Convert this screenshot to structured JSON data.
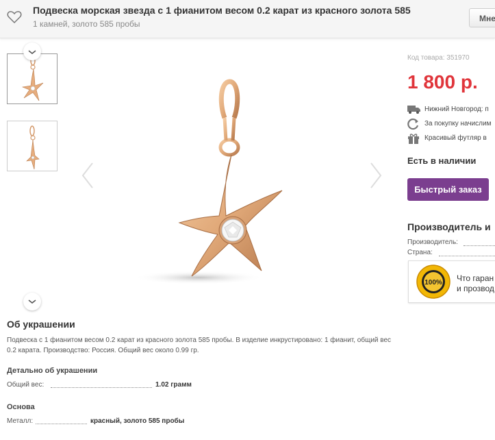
{
  "header": {
    "title": "Подвеска морская звезда с 1 фианитом весом 0.2 карат из красного золота 585",
    "subtitle": "1 камней, золото 585 пробы",
    "menu_label": "Мне"
  },
  "gallery": {
    "thumbnails": [
      {
        "icon": "starfish-pendant-front"
      },
      {
        "icon": "starfish-pendant-side"
      }
    ],
    "up_icon": "chevron-up-icon",
    "down_icon": "chevron-down-icon",
    "prev_icon": "chevron-left-icon",
    "next_icon": "chevron-right-icon"
  },
  "product": {
    "sku": "Код товара: 351970",
    "price": "1 800 р.",
    "delivery": "Нижний Новгород: п",
    "bonus": "За покупку начислим",
    "gift_box": "Красивый футляр в",
    "stock": "Есть в наличии",
    "quick_order": "Быстрый заказ"
  },
  "manufacturer": {
    "title": "Производитель и",
    "producer_label": "Производитель:",
    "country_label": "Страна:"
  },
  "guarantee": {
    "line1": "Что гаран",
    "line2": "и прозвод",
    "seal_text": "100%"
  },
  "about": {
    "title": "Об украшении",
    "text": "Подвеска с 1 фианитом весом 0.2 карат из красного золота 585 пробы. В изделие инкрустировано: 1 фианит, общий вес 0.2 карата. Производство: Россия. Общий вес около 0.99 гр."
  },
  "details": {
    "title": "Детально об украшении",
    "weight_label": "Общий вес:",
    "weight_value": "1.02 грамм"
  },
  "basis": {
    "title": "Основа",
    "metal_label": "Металл:",
    "metal_value": "красный, золото 585 пробы"
  },
  "colors": {
    "price": "#e0353b",
    "button": "#7b3e8f",
    "gold": "#e0a878"
  }
}
